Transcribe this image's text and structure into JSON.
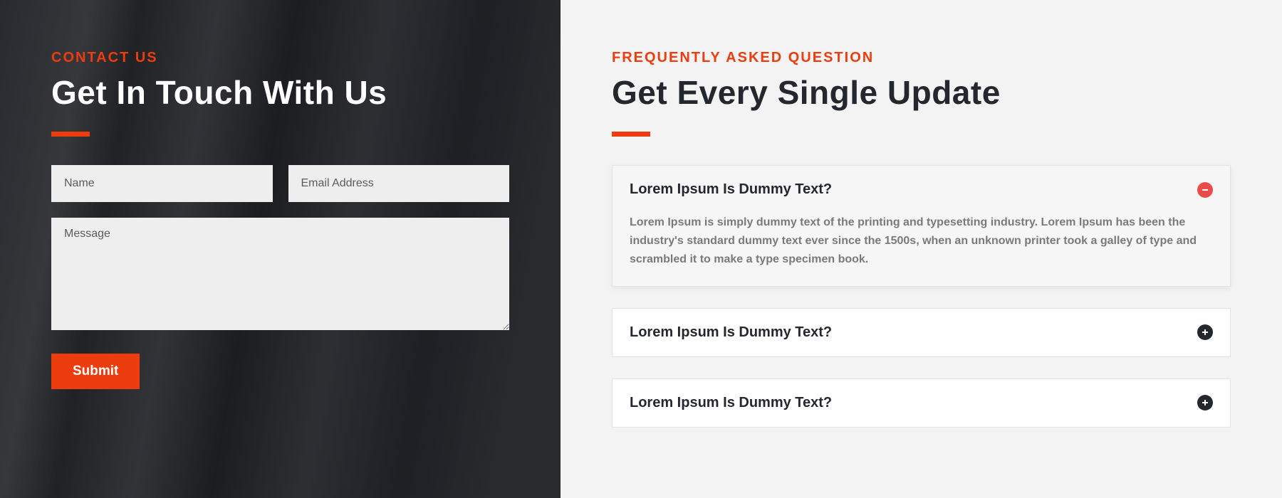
{
  "contact": {
    "eyebrow": "CONTACT US",
    "heading": "Get In Touch With Us",
    "name_placeholder": "Name",
    "email_placeholder": "Email Address",
    "message_placeholder": "Message",
    "submit_label": "Submit"
  },
  "faq": {
    "eyebrow": "FREQUENTLY ASKED QUESTION",
    "heading": "Get Every Single Update",
    "items": [
      {
        "question": "Lorem Ipsum Is Dummy Text?",
        "answer": "Lorem Ipsum is simply dummy text of the printing and typesetting industry. Lorem Ipsum has been the industry's standard dummy text ever since the 1500s, when an unknown printer took a galley of type and scrambled it to make a type specimen book.",
        "expanded": true
      },
      {
        "question": "Lorem Ipsum Is Dummy Text?",
        "expanded": false
      },
      {
        "question": "Lorem Ipsum Is Dummy Text?",
        "expanded": false
      }
    ]
  }
}
